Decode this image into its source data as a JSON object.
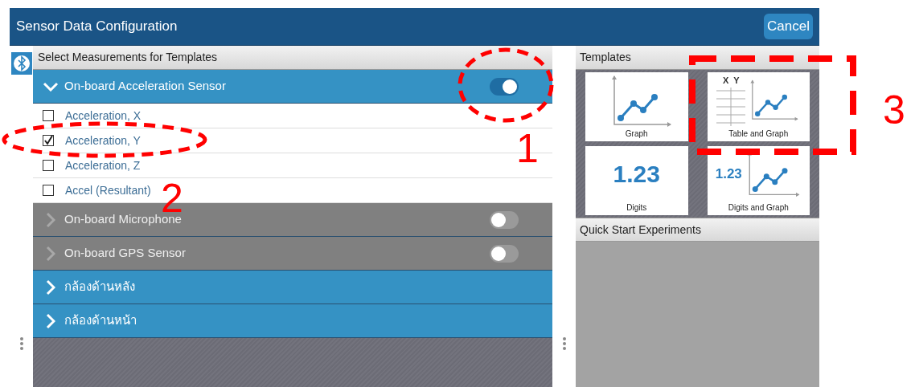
{
  "window": {
    "title": "Sensor Data Configuration",
    "cancel_button": "Cancel"
  },
  "measurements": {
    "header": "Select Measurements for Templates",
    "sensors": [
      {
        "name": "On-board Acceleration Sensor",
        "kind": "toggle",
        "on": true,
        "expanded": true,
        "items": [
          {
            "label": "Acceleration, X",
            "checked": false
          },
          {
            "label": "Acceleration, Y",
            "checked": true
          },
          {
            "label": "Acceleration, Z",
            "checked": false
          },
          {
            "label": "Accel (Resultant)",
            "checked": false
          }
        ]
      },
      {
        "name": "On-board Microphone",
        "kind": "toggle",
        "on": false,
        "expanded": false
      },
      {
        "name": "On-board GPS Sensor",
        "kind": "toggle",
        "on": false,
        "expanded": false
      },
      {
        "name": "กล้องด้านหลัง",
        "kind": "plain",
        "expanded": false
      },
      {
        "name": "กล้องด้านหน้า",
        "kind": "plain",
        "expanded": false
      }
    ]
  },
  "templates": {
    "header": "Templates",
    "tiles": [
      {
        "label": "Graph",
        "kind": "graph"
      },
      {
        "label": "Table and Graph",
        "kind": "table_graph"
      },
      {
        "label": "Digits",
        "kind": "digits",
        "digits": "1.23"
      },
      {
        "label": "Digits and Graph",
        "kind": "digits_graph",
        "digits": "1.23"
      }
    ],
    "table_columns": [
      "X",
      "Y"
    ]
  },
  "quick_start": {
    "header": "Quick Start Experiments"
  },
  "annotations": [
    {
      "number": "1",
      "kind": "ellipse"
    },
    {
      "number": "2",
      "kind": "ellipse"
    },
    {
      "number": "3",
      "kind": "rectangle"
    }
  ]
}
